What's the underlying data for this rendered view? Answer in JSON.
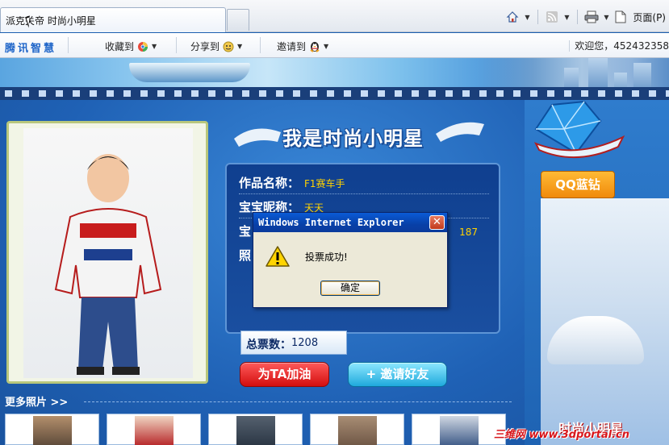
{
  "browser": {
    "tab_title": "派克关帝 时尚小明星",
    "command_bar": {
      "page_label": "页面(P)",
      "icons": [
        "home-icon",
        "feeds-icon",
        "print-icon",
        "page-icon"
      ]
    }
  },
  "qq_toolbar": {
    "brand": "腾讯智慧",
    "collect": "收藏到",
    "share": "分享到",
    "invite": "邀请到",
    "welcome": "欢迎您，452432358"
  },
  "page": {
    "section_title": "我是时尚小明星",
    "work_name_label": "作品名称：",
    "work_name": "F1赛车手",
    "nickname_label": "宝宝昵称：",
    "nickname": "天天",
    "row3_label_partial": "宝",
    "row3_value": "187",
    "row4_label_partial": "照",
    "total_votes_label": "总票数：",
    "total_votes": "1208",
    "vote_button": "为TA加油",
    "invite_button": "+ 邀请好友",
    "more_photos": "更多照片 >>",
    "qq_badge": "QQ蓝钻",
    "promo": "时尚小明星",
    "watermark": "三维网 www.3dportal.cn",
    "colors": {
      "accent_blue": "#1c5fb0",
      "vote_red": "#d30e0e",
      "invite_cyan": "#1fa9dc",
      "label_yellow": "#ffd200"
    }
  },
  "dialog": {
    "title": "Windows Internet Explorer",
    "message": "投票成功!",
    "ok_label": "确定",
    "icon": "warning-icon"
  }
}
